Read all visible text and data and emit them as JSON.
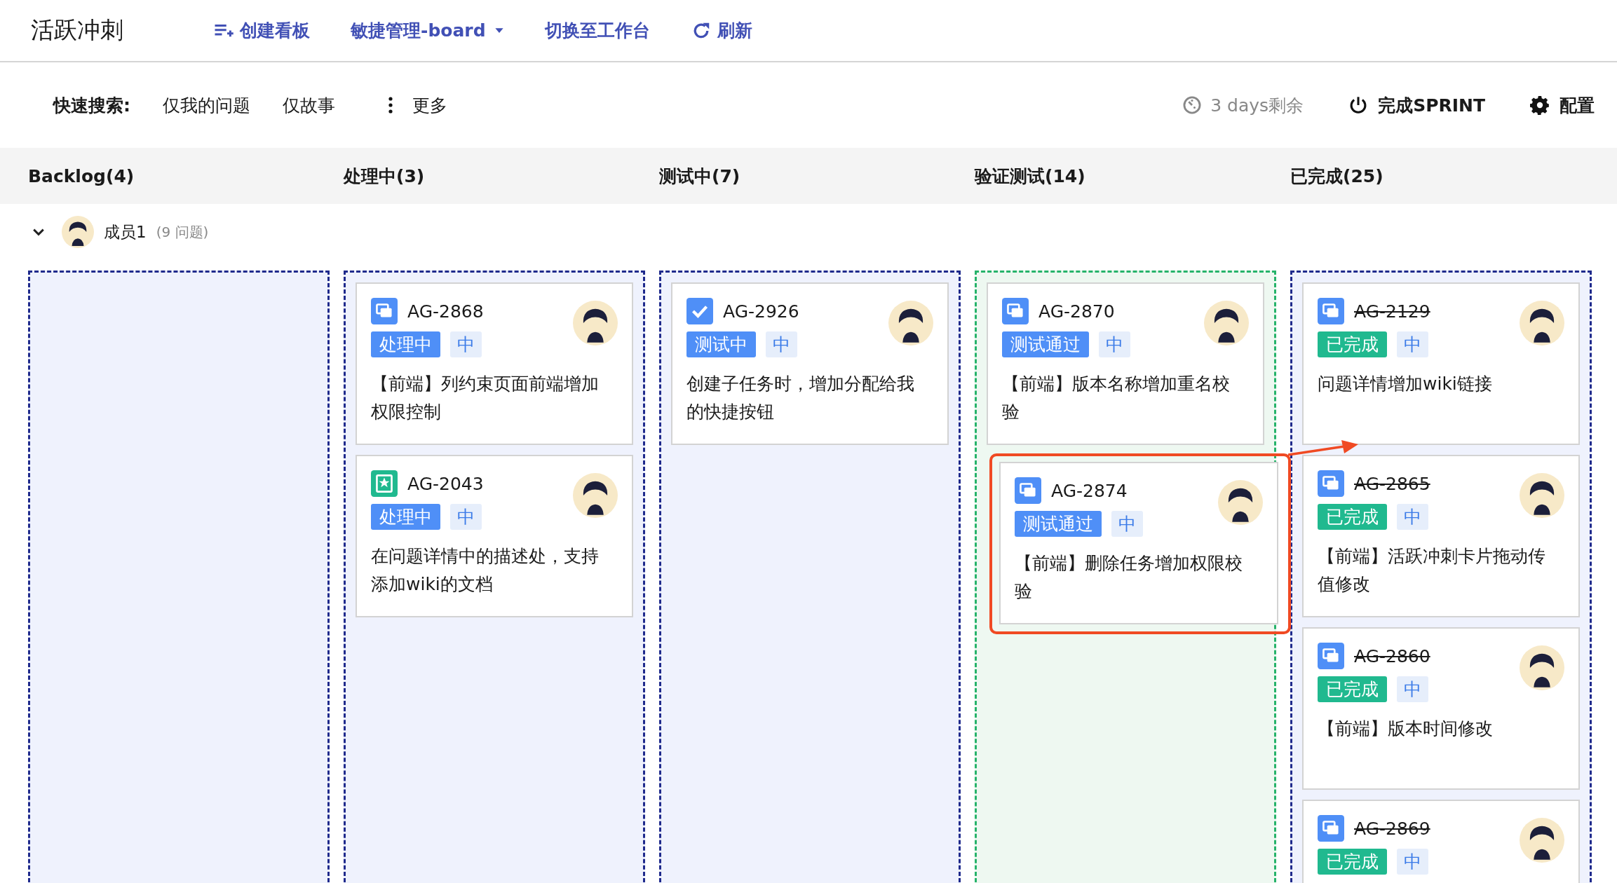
{
  "header": {
    "title": "活跃冲刺",
    "nav": [
      {
        "kind": "create",
        "label": "创建看板"
      },
      {
        "kind": "dropdown",
        "label": "敏捷管理-board"
      },
      {
        "kind": "link",
        "label": "切换至工作台"
      },
      {
        "kind": "refresh",
        "label": "刷新"
      }
    ]
  },
  "toolbar": {
    "quick_search_label": "快速搜索:",
    "filters": [
      "仅我的问题",
      "仅故事"
    ],
    "more": "更多",
    "remaining": "3 days剩余",
    "complete_sprint": "完成SPRINT",
    "settings": "配置"
  },
  "swimlane": {
    "name": "成员1",
    "count": "(9 问题)",
    "expanded": true
  },
  "columns": [
    {
      "title": "Backlog(4)",
      "highlighted": false
    },
    {
      "title": "处理中(3)",
      "highlighted": false,
      "cards": [
        {
          "kind": "task",
          "id": "AG-2868",
          "resolved": false,
          "status": "处理中",
          "color": "#4f8ff7",
          "priority": "中",
          "summary": "【前端】列约束页面前端增加权限控制",
          "dragged": false
        },
        {
          "kind": "story",
          "id": "AG-2043",
          "resolved": false,
          "status": "处理中",
          "color": "#4f8ff7",
          "priority": "中",
          "summary": "在问题详情中的描述处，支持添加wiki的文档",
          "dragged": false
        }
      ]
    },
    {
      "title": "测试中(7)",
      "highlighted": false,
      "cards": [
        {
          "kind": "subtask",
          "id": "AG-2926",
          "resolved": false,
          "status": "测试中",
          "color": "#4f8ff7",
          "priority": "中",
          "summary": "创建子任务时，增加分配给我的快捷按钮",
          "dragged": false
        }
      ]
    },
    {
      "title": "验证测试(14)",
      "highlighted": true,
      "cards": [
        {
          "kind": "task",
          "id": "AG-2870",
          "resolved": false,
          "status": "测试通过",
          "color": "#4f8ff7",
          "priority": "中",
          "summary": "【前端】版本名称增加重名校验",
          "dragged": false
        },
        {
          "kind": "task",
          "id": "AG-2874",
          "resolved": false,
          "status": "测试通过",
          "color": "#4f8ff7",
          "priority": "中",
          "summary": "【前端】删除任务增加权限校验",
          "dragged": true
        }
      ]
    },
    {
      "title": "已完成(25)",
      "highlighted": false,
      "cards": [
        {
          "kind": "task",
          "id": "AG-2129",
          "resolved": true,
          "status": "已完成",
          "color": "#20b98f",
          "priority": "中",
          "summary": "问题详情增加wiki链接",
          "dragged": false
        },
        {
          "kind": "task",
          "id": "AG-2865",
          "resolved": true,
          "status": "已完成",
          "color": "#20b98f",
          "priority": "中",
          "summary": "【前端】活跃冲刺卡片拖动传值修改",
          "dragged": false
        },
        {
          "kind": "task",
          "id": "AG-2860",
          "resolved": true,
          "status": "已完成",
          "color": "#20b98f",
          "priority": "中",
          "summary": "【前端】版本时间修改",
          "dragged": false
        },
        {
          "kind": "task",
          "id": "AG-2869",
          "resolved": true,
          "status": "已完成",
          "color": "#20b98f",
          "priority": "中",
          "dragged": false
        }
      ]
    }
  ]
}
